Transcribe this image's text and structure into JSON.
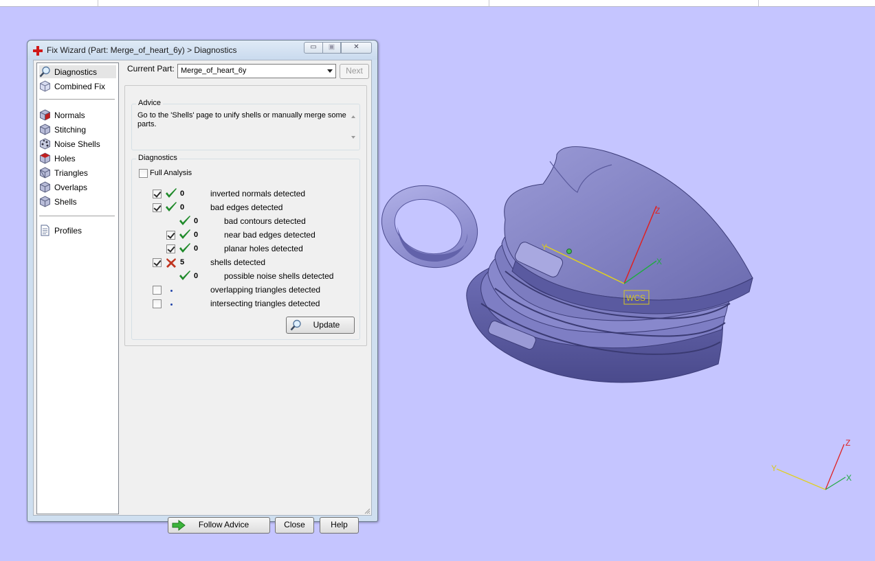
{
  "window": {
    "title": "Fix Wizard (Part: Merge_of_heart_6y) > Diagnostics",
    "controls": {
      "minimize": "▭",
      "maximize": "▣",
      "close": "✕"
    }
  },
  "nav": {
    "top": [
      {
        "label": "Diagnostics",
        "icon": "magnifier-icon",
        "selected": true
      },
      {
        "label": "Combined Fix",
        "icon": "cube-icon",
        "selected": false
      }
    ],
    "fixes": [
      {
        "label": "Normals",
        "icon": "normals-cube-icon"
      },
      {
        "label": "Stitching",
        "icon": "stitching-cube-icon"
      },
      {
        "label": "Noise Shells",
        "icon": "noise-shells-icon"
      },
      {
        "label": "Holes",
        "icon": "holes-cube-icon"
      },
      {
        "label": "Triangles",
        "icon": "triangles-cube-icon"
      },
      {
        "label": "Overlaps",
        "icon": "overlaps-cube-icon"
      },
      {
        "label": "Shells",
        "icon": "shells-cube-icon"
      }
    ],
    "bottom": [
      {
        "label": "Profiles",
        "icon": "document-icon"
      }
    ]
  },
  "current_part": {
    "label": "Current Part:",
    "value": "Merge_of_heart_6y",
    "next_label": "Next"
  },
  "advice": {
    "title": "Advice",
    "text": "Go to the 'Shells' page to unify shells or manually merge some parts."
  },
  "diagnostics": {
    "title": "Diagnostics",
    "full_analysis_label": "Full Analysis",
    "full_analysis_checked": false,
    "rows": [
      {
        "label": "inverted normals detected",
        "count": "0",
        "status": "ok",
        "checkbox": true,
        "checked": true,
        "indent": 0
      },
      {
        "label": "bad edges detected",
        "count": "0",
        "status": "ok",
        "checkbox": true,
        "checked": true,
        "indent": 0
      },
      {
        "label": "bad contours detected",
        "count": "0",
        "status": "ok",
        "checkbox": false,
        "checked": false,
        "indent": 1
      },
      {
        "label": "near bad edges detected",
        "count": "0",
        "status": "ok",
        "checkbox": true,
        "checked": true,
        "indent": 1
      },
      {
        "label": "planar holes detected",
        "count": "0",
        "status": "ok",
        "checkbox": true,
        "checked": true,
        "indent": 1
      },
      {
        "label": "shells detected",
        "count": "5",
        "status": "error",
        "checkbox": true,
        "checked": true,
        "indent": 0
      },
      {
        "label": "possible noise shells detected",
        "count": "0",
        "status": "ok",
        "checkbox": false,
        "checked": false,
        "indent": 1
      },
      {
        "label": "overlapping triangles detected",
        "count": "",
        "status": "pending",
        "checkbox": true,
        "checked": false,
        "indent": 0
      },
      {
        "label": "intersecting triangles detected",
        "count": "",
        "status": "pending",
        "checkbox": true,
        "checked": false,
        "indent": 0
      }
    ],
    "update_label": "Update"
  },
  "footer": {
    "follow_advice_label": "Follow Advice",
    "close_label": "Close",
    "help_label": "Help"
  },
  "viewport": {
    "background": "#c5c5ff",
    "wcs_label": "WCS",
    "axis_labels": {
      "x": "X",
      "y": "Y",
      "z": "Z"
    },
    "axis_colors": {
      "x": "#22aa44",
      "y": "#e0d020",
      "z": "#e02020"
    }
  }
}
